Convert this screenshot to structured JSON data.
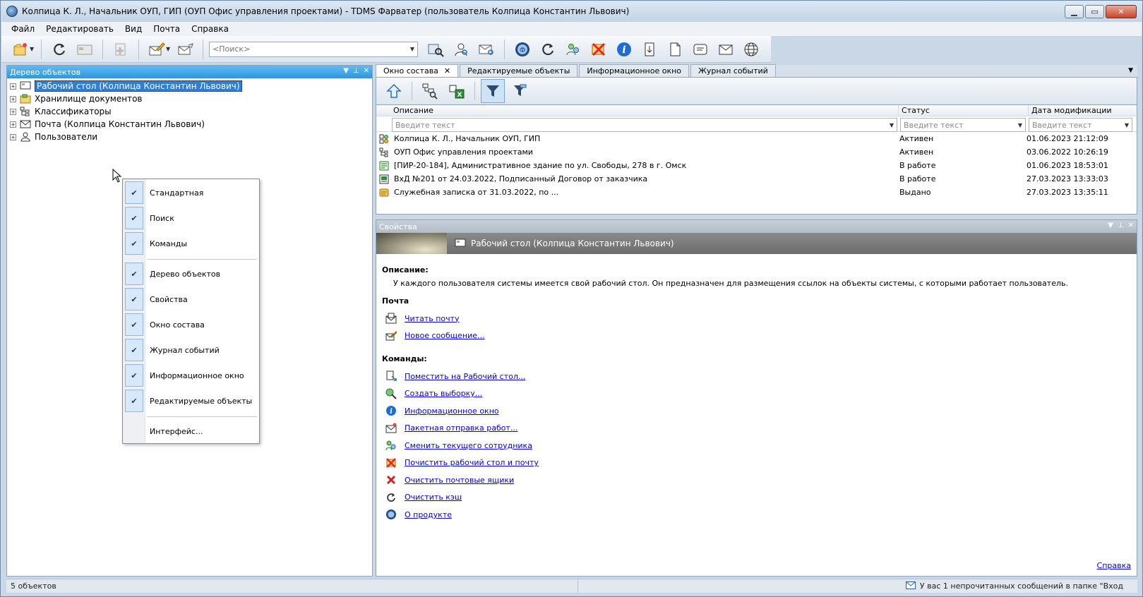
{
  "window": {
    "title": "Колпица К. Л., Начальник ОУП, ГИП (ОУП Офис управления проектами) - TDMS Фарватер (пользователь Колпица Константин Львович)",
    "minimize": "▁",
    "maximize": "▭",
    "close": "✕"
  },
  "menu": [
    "Файл",
    "Редактировать",
    "Вид",
    "Почта",
    "Справка"
  ],
  "toolbar": {
    "search_placeholder": "<Поиск>"
  },
  "left_panel": {
    "title": "Дерево объектов",
    "tree": [
      {
        "label": "Рабочий стол (Колпица Константин Львович)",
        "selected": true,
        "icon": "desktop-icon"
      },
      {
        "label": "Хранилище документов",
        "icon": "storage-icon"
      },
      {
        "label": "Классификаторы",
        "icon": "classifier-icon"
      },
      {
        "label": "Почта (Колпица Константин Львович)",
        "icon": "mail-icon"
      },
      {
        "label": "Пользователи",
        "icon": "users-icon"
      }
    ]
  },
  "context_menu": {
    "items": [
      {
        "label": "Стандартная",
        "checked": true
      },
      {
        "label": "Поиск",
        "checked": true
      },
      {
        "label": "Команды",
        "checked": true
      },
      {
        "label": "Дерево объектов",
        "checked": true
      },
      {
        "label": "Свойства",
        "checked": true
      },
      {
        "label": "Окно состава",
        "checked": true
      },
      {
        "label": "Журнал событий",
        "checked": true
      },
      {
        "label": "Информационное окно",
        "checked": true
      },
      {
        "label": "Редактируемые объекты",
        "checked": true
      },
      {
        "label": "Интерфейс...",
        "checked": false
      }
    ]
  },
  "tabs": [
    {
      "label": "Окно состава",
      "active": true,
      "close": "✕"
    },
    {
      "label": "Редактируемые объекты"
    },
    {
      "label": "Информационное окно"
    },
    {
      "label": "Журнал событий"
    }
  ],
  "grid": {
    "columns": [
      "Описание",
      "Статус",
      "Дата модификации"
    ],
    "filter_placeholder": "Введите текст",
    "rows": [
      {
        "description": "Колпица К. Л., Начальник ОУП, ГИП",
        "status": "Активен",
        "date": "01.06.2023 21:12:09"
      },
      {
        "description": "ОУП Офис управления проектами",
        "status": "Активен",
        "date": "03.06.2022 10:26:19"
      },
      {
        "description": "[ПИР-20-184], Административное здание по ул. Свободы, 278 в г. Омск",
        "status": "В работе",
        "date": "01.06.2023 18:53:01"
      },
      {
        "description": "ВхД №201 от 24.03.2022, Подписанный Договор от заказчика",
        "status": "В работе",
        "date": "27.03.2023 13:33:03"
      },
      {
        "description": "Служебная записка от 31.03.2022, по ...",
        "status": "Выдано",
        "date": "27.03.2023 13:35:11"
      }
    ]
  },
  "properties": {
    "panel_title": "Свойства",
    "banner_title": "Рабочий стол (Колпица Константин Львович)",
    "description_heading": "Описание:",
    "description_text": "У каждого пользователя системы имеется свой рабочий стол. Он предназначен для размещения ссылок на объекты системы, с которыми работает пользователь.",
    "mail_heading": "Почта",
    "mail_links": [
      "Читать почту",
      "Новое сообщение..."
    ],
    "commands_heading": "Команды:",
    "command_links": [
      "Поместить на Рабочий стол...",
      "Создать выборку...",
      "Информационное окно",
      "Пакетная отправка работ...",
      "Сменить текущего сотрудника",
      "Почистить рабочий стол и почту",
      "Очистить почтовые ящики",
      "Очистить кэш",
      "О продукте"
    ],
    "help_link": "Справка"
  },
  "statusbar": {
    "count": "5 объектов",
    "message": "У вас 1 непрочитанных сообщений в папке \"Вход"
  },
  "colors": {
    "accent": "#2f96e0",
    "link": "#0000ee",
    "selection": "#2f7fd6"
  }
}
